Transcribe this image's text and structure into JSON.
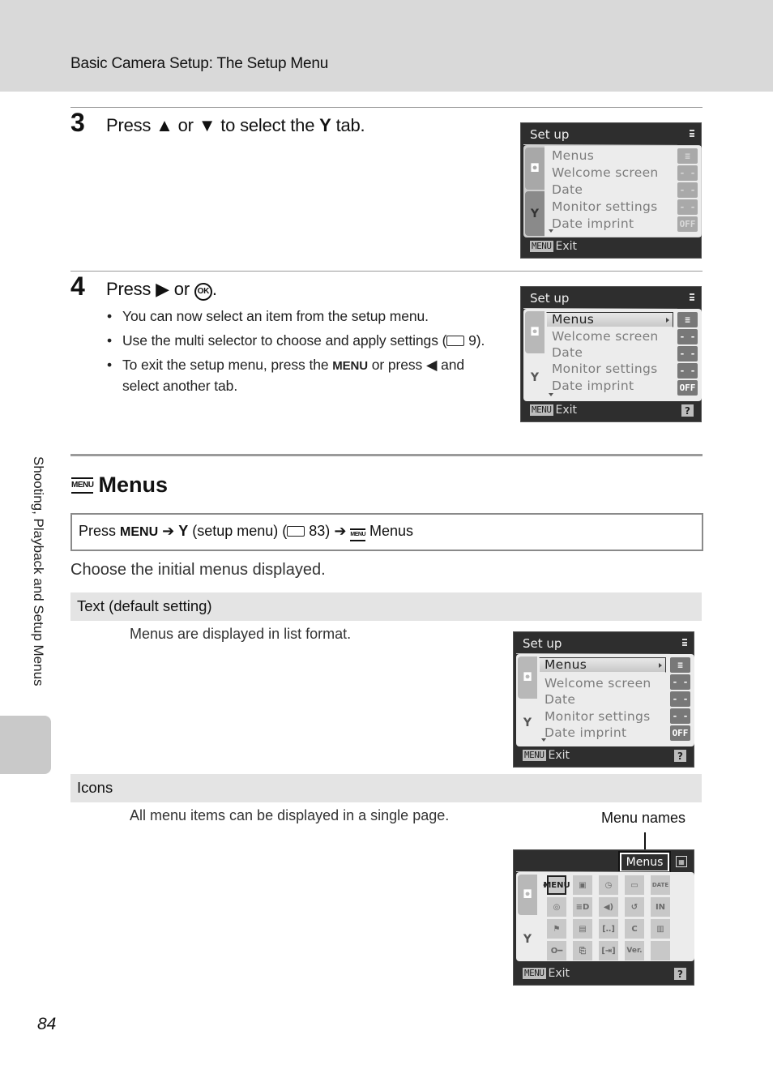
{
  "header": {
    "title": "Basic Camera Setup: The Setup Menu"
  },
  "side_tab": {
    "label": "Shooting, Playback and Setup Menus"
  },
  "page_number": "84",
  "steps": [
    {
      "number": "3",
      "parts": {
        "a": "Press ",
        "up": "▲",
        "b": " or ",
        "down": "▼",
        "c": " to select the ",
        "tab_icon": "Y",
        "d": " tab."
      }
    },
    {
      "number": "4",
      "parts": {
        "a": "Press ",
        "right": "▶",
        "b": " or ",
        "ok": "OK",
        "c": "."
      },
      "bullets": [
        {
          "text": "You can now select an item from the setup menu."
        },
        {
          "text": "Use the multi selector to choose and apply settings (",
          "ref_icon": "book-icon",
          "ref": " 9)."
        },
        {
          "a": "To exit the setup menu, press the ",
          "menu": "MENU",
          "b": " or press ",
          "left": "◀",
          "c": " and select another tab."
        }
      ]
    }
  ],
  "section": {
    "icon_label": "MENU",
    "title": "Menus",
    "nav": {
      "press": "Press ",
      "menu": "MENU",
      "arrow": " ➔ ",
      "setup_icon": "Y",
      "setup_text": " (setup menu) (",
      "ref": " 83)",
      "arrow2": " ➔ ",
      "menus_icon": "MENU",
      "menus_text": " Menus"
    },
    "intro": "Choose the initial menus displayed.",
    "options": [
      {
        "name": "Text (default setting)",
        "desc": "Menus are displayed in list format."
      },
      {
        "name": "Icons",
        "desc": "All menu items can be displayed in a single page."
      }
    ],
    "callout": "Menu names"
  },
  "camera_screens": {
    "title": "Set up",
    "exit_label": "Exit",
    "menu_chip": "MENU",
    "help": "?",
    "items": [
      {
        "label": "Menus",
        "value": "≡"
      },
      {
        "label": "Welcome screen",
        "value": "- -"
      },
      {
        "label": "Date",
        "value": "- -"
      },
      {
        "label": "Monitor settings",
        "value": "- -"
      },
      {
        "label": "Date imprint",
        "value": "OFF"
      }
    ],
    "icons_view": {
      "menu_name": "Menus",
      "grid": [
        [
          "MENU",
          "▣",
          "◷",
          "▭",
          "DATE"
        ],
        [
          "◎",
          "≡D",
          "◀)",
          "↺",
          "IN"
        ],
        [
          "⚑",
          "▤",
          "[‥]",
          "C",
          "▥"
        ],
        [
          "O━",
          "⎘",
          "[⇥]",
          "Ver.",
          ""
        ]
      ]
    }
  }
}
